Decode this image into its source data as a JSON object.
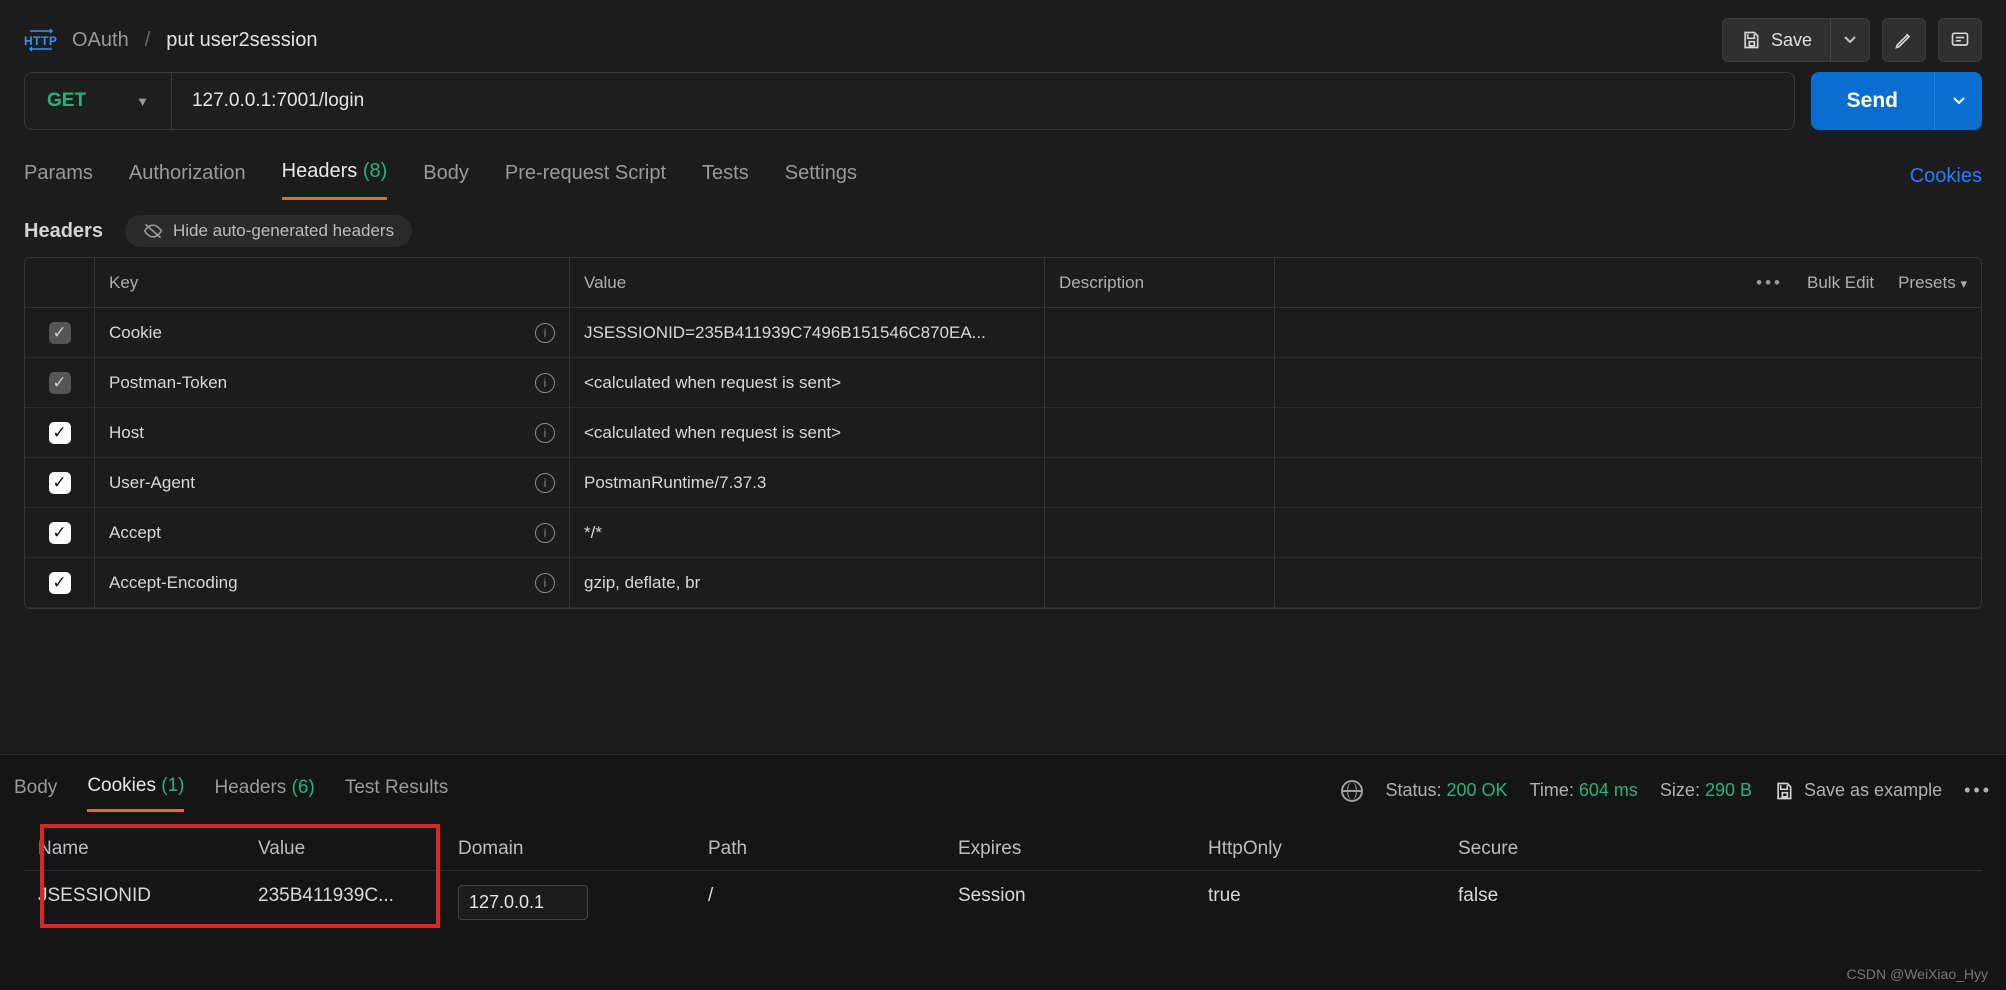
{
  "breadcrumb": {
    "folder": "OAuth",
    "sep": "/",
    "request": "put user2session"
  },
  "topbar": {
    "save": "Save"
  },
  "request": {
    "method": "GET",
    "url": "127.0.0.1:7001/login",
    "send": "Send"
  },
  "tabs": {
    "params": "Params",
    "auth": "Authorization",
    "headers": "Headers",
    "headers_count": "(8)",
    "body": "Body",
    "prerequest": "Pre-request Script",
    "tests": "Tests",
    "settings": "Settings",
    "cookies_link": "Cookies"
  },
  "headers_section": {
    "title": "Headers",
    "hide_auto": "Hide auto-generated headers",
    "columns": {
      "key": "Key",
      "value": "Value",
      "description": "Description",
      "bulk": "Bulk Edit",
      "presets": "Presets"
    },
    "rows": [
      {
        "checked": true,
        "dim": true,
        "key": "Cookie",
        "value": "JSESSIONID=235B411939C7496B151546C870EA..."
      },
      {
        "checked": true,
        "dim": true,
        "key": "Postman-Token",
        "value": "<calculated when request is sent>"
      },
      {
        "checked": true,
        "dim": false,
        "key": "Host",
        "value": "<calculated when request is sent>"
      },
      {
        "checked": true,
        "dim": false,
        "key": "User-Agent",
        "value": "PostmanRuntime/7.37.3"
      },
      {
        "checked": true,
        "dim": false,
        "key": "Accept",
        "value": "*/*"
      },
      {
        "checked": true,
        "dim": false,
        "key": "Accept-Encoding",
        "value": "gzip, deflate, br"
      }
    ]
  },
  "response": {
    "tabs": {
      "body": "Body",
      "cookies": "Cookies",
      "cookies_count": "(1)",
      "headers": "Headers",
      "headers_count": "(6)",
      "tests": "Test Results"
    },
    "status_label": "Status:",
    "status_value": "200 OK",
    "time_label": "Time:",
    "time_value": "604 ms",
    "size_label": "Size:",
    "size_value": "290 B",
    "save_example": "Save as example",
    "cookie_columns": {
      "name": "Name",
      "value": "Value",
      "domain": "Domain",
      "path": "Path",
      "expires": "Expires",
      "httponly": "HttpOnly",
      "secure": "Secure"
    },
    "cookie_row": {
      "name": "JSESSIONID",
      "value": "235B411939C...",
      "domain": "127.0.0.1",
      "path": "/",
      "expires": "Session",
      "httponly": "true",
      "secure": "false"
    }
  },
  "watermark": "CSDN @WeiXiao_Hyy"
}
